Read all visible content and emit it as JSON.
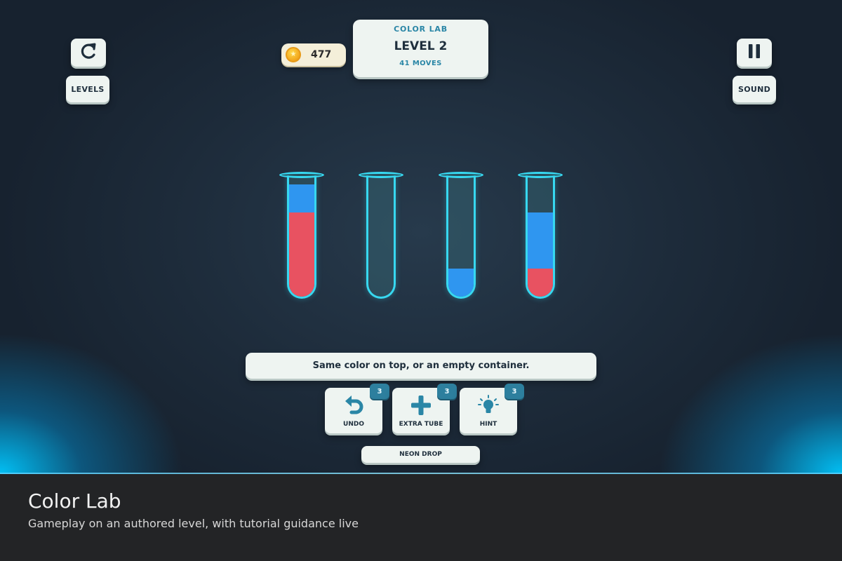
{
  "game": {
    "restart_icon": "restart-icon",
    "levels_label": "LEVELS",
    "pause_icon": "pause-icon",
    "sound_label": "SOUND",
    "coins": "477",
    "coin_icon": "star-coin-icon",
    "brand": "COLOR LAB",
    "level_title": "LEVEL 2",
    "moves": "41 MOVES",
    "colors": {
      "red": "#e85261",
      "blue": "#2f96f0",
      "tube_outline": "#37d8f0",
      "accent": "#2a86a6"
    },
    "tubes": [
      {
        "capacity": 4,
        "layers_bottom_to_top": [
          "red",
          "red",
          "red",
          "blue"
        ]
      },
      {
        "capacity": 4,
        "layers_bottom_to_top": []
      },
      {
        "capacity": 4,
        "layers_bottom_to_top": [
          "blue"
        ]
      },
      {
        "capacity": 4,
        "layers_bottom_to_top": [
          "red",
          "blue",
          "blue"
        ]
      }
    ],
    "tutorial_text": "Same color on top, or an empty container.",
    "powerups": [
      {
        "label": "UNDO",
        "count": "3",
        "icon": "undo-arrow-icon"
      },
      {
        "label": "EXTRA TUBE",
        "count": "3",
        "icon": "plus-icon"
      },
      {
        "label": "HINT",
        "count": "3",
        "icon": "lightbulb-icon"
      }
    ],
    "theme_label": "NEON DROP"
  },
  "caption": {
    "title": "Color Lab",
    "subtitle": "Gameplay on an authored level, with tutorial guidance live"
  }
}
